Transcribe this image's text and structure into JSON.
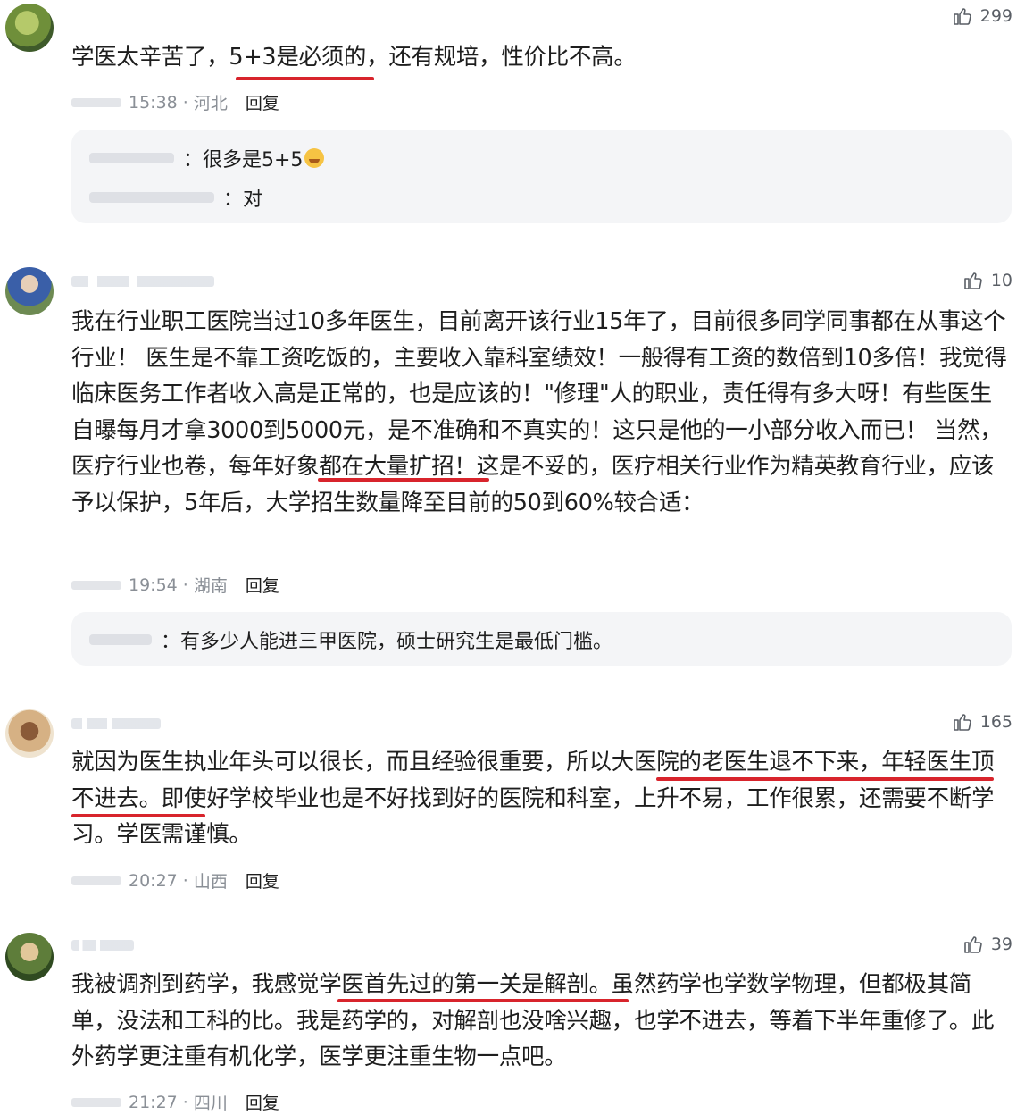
{
  "comments": [
    {
      "likes": "299",
      "text": "学医太辛苦了，5+3是必须的，还有规培，性价比不高。",
      "time": "15:38",
      "location": "河北",
      "reply_label": "回复",
      "replies": [
        {
          "text": "：很多是5+5"
        },
        {
          "text": "：对"
        }
      ]
    },
    {
      "likes": "10",
      "text": "我在行业职工医院当过10多年医生，目前离开该行业15年了，目前很多同学同事都在从事这个行业！ 医生是不靠工资吃饭的，主要收入靠科室绩效！一般得有工资的数倍到10多倍！我觉得临床医务工作者收入高是正常的，也是应该的！\"修理\"人的职业，责任得有多大呀！有些医生自曝每月才拿3000到5000元，是不准确和不真实的！这只是他的一小部分收入而已！ 当然，医疗行业也卷，每年好象都在大量扩招！这是不妥的，医疗相关行业作为精英教育行业，应该予以保护，5年后，大学招生数量降至目前的50到60%较合适：",
      "time": "19:54",
      "location": "湖南",
      "reply_label": "回复",
      "replies": [
        {
          "text": "：有多少人能进三甲医院，硕士研究生是最低门槛。"
        }
      ]
    },
    {
      "likes": "165",
      "text": "就因为医生执业年头可以很长，而且经验很重要，所以大医院的老医生退不下来，年轻医生顶不进去。即使好学校毕业也是不好找到好的医院和科室，上升不易，工作很累，还需要不断学习。学医需谨慎。",
      "time": "20:27",
      "location": "山西",
      "reply_label": "回复"
    },
    {
      "likes": "39",
      "text": "我被调剂到药学，我感觉学医首先过的第一关是解剖。虽然药学也学数学物理，但都极其简单，没法和工科的比。我是药学的，对解剖也没啥兴趣，也学不进去，等着下半年重修了。此外药学更注重有机化学，医学更注重生物一点吧。",
      "time": "21:27",
      "location": "四川",
      "reply_label": "回复"
    }
  ],
  "colors": {
    "underline": "#d8242c",
    "reply_bg": "#f4f5f7",
    "meta": "#8a8f96"
  },
  "icons": {
    "like": "thumbs-up-icon",
    "emoji": "crying-laughing-emoji"
  }
}
